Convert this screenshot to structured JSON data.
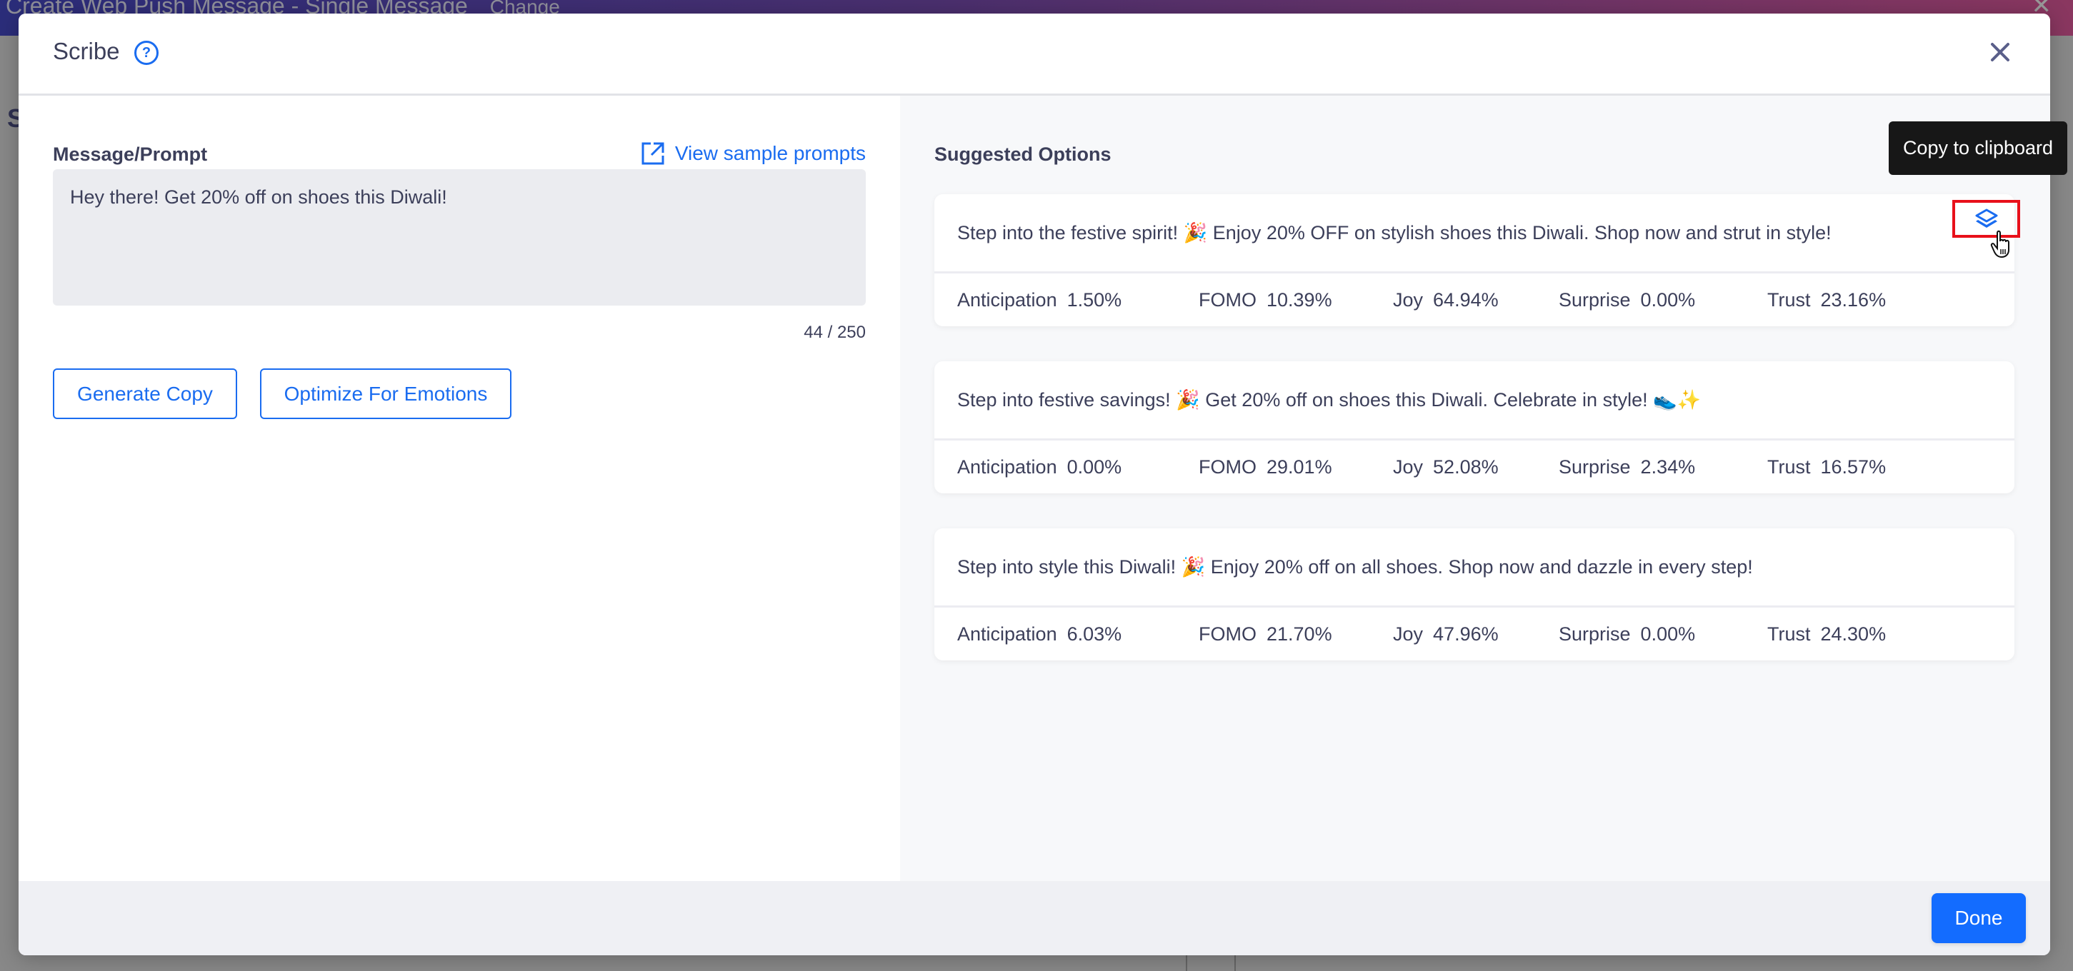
{
  "background_app": {
    "title": "Create Web Push Message - Single Message",
    "change_link": "Change",
    "partial_heading": "S"
  },
  "modal": {
    "title": "Scribe",
    "help_icon": "question-circle-icon",
    "close_icon": "close-icon"
  },
  "left": {
    "label": "Message/Prompt",
    "sample_link": "View sample prompts",
    "sample_link_icon": "external-link-icon",
    "prompt_value": "Hey there! Get 20% off on shoes this Diwali!",
    "counter": "44 / 250",
    "generate_button": "Generate Copy",
    "optimize_button": "Optimize For Emotions"
  },
  "right": {
    "title": "Suggested Options",
    "tooltip": "Copy to clipboard",
    "copy_icon": "copy-layers-icon",
    "options": [
      {
        "text": "Step into the festive spirit! 🎉 Enjoy 20% OFF on stylish shoes this Diwali. Shop now and strut in style!",
        "metrics": [
          {
            "label": "Anticipation",
            "value": "1.50%"
          },
          {
            "label": "FOMO",
            "value": "10.39%"
          },
          {
            "label": "Joy",
            "value": "64.94%"
          },
          {
            "label": "Surprise",
            "value": "0.00%"
          },
          {
            "label": "Trust",
            "value": "23.16%"
          }
        ]
      },
      {
        "text": "Step into festive savings! 🎉 Get 20% off on shoes this Diwali. Celebrate in style! 👟✨",
        "metrics": [
          {
            "label": "Anticipation",
            "value": "0.00%"
          },
          {
            "label": "FOMO",
            "value": "29.01%"
          },
          {
            "label": "Joy",
            "value": "52.08%"
          },
          {
            "label": "Surprise",
            "value": "2.34%"
          },
          {
            "label": "Trust",
            "value": "16.57%"
          }
        ]
      },
      {
        "text": "Step into style this Diwali! 🎉 Enjoy 20% off on all shoes. Shop now and dazzle in every step!",
        "metrics": [
          {
            "label": "Anticipation",
            "value": "6.03%"
          },
          {
            "label": "FOMO",
            "value": "21.70%"
          },
          {
            "label": "Joy",
            "value": "47.96%"
          },
          {
            "label": "Surprise",
            "value": "0.00%"
          },
          {
            "label": "Trust",
            "value": "24.30%"
          }
        ]
      }
    ]
  },
  "footer": {
    "done_button": "Done"
  },
  "colors": {
    "accent": "#1a6cf0",
    "primary_button": "#136cff",
    "highlight_box": "#e8101a",
    "text": "#3c3f5a",
    "tooltip_bg": "#171717"
  }
}
